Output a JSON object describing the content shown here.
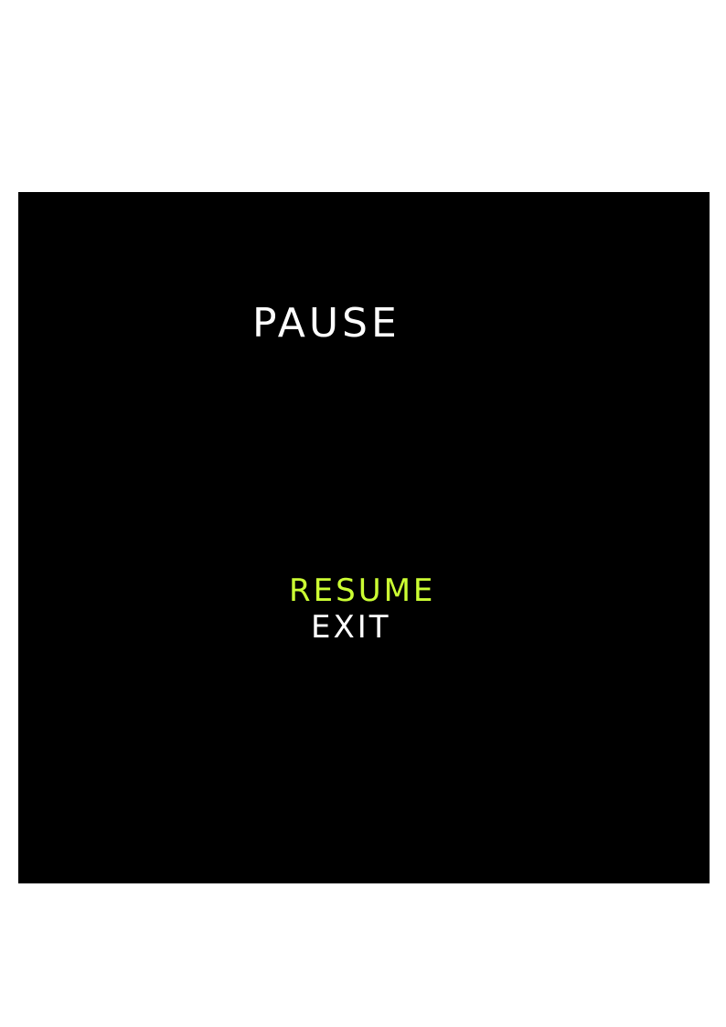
{
  "pause_menu": {
    "title": "PAUSE",
    "items": [
      {
        "label": "RESUME",
        "selected": true
      },
      {
        "label": "EXIT",
        "selected": false
      }
    ]
  },
  "colors": {
    "background": "#000000",
    "text": "#ffffff",
    "selected": "#ccff33"
  }
}
